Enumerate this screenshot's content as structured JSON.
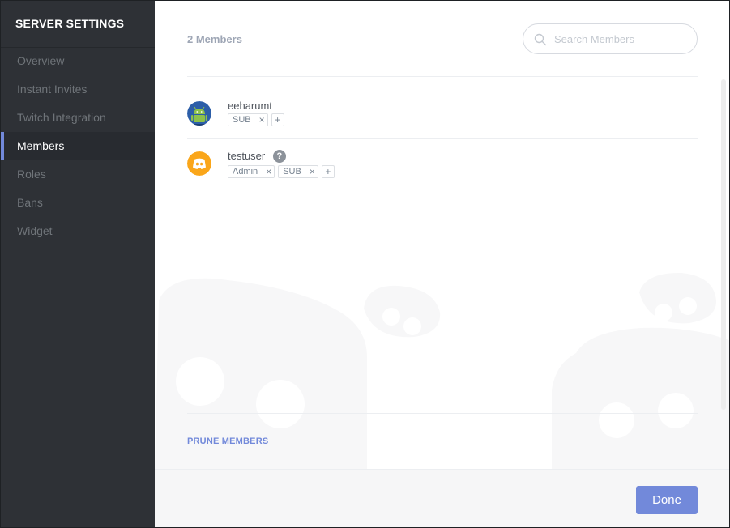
{
  "sidebar": {
    "title": "SERVER SETTINGS",
    "items": [
      {
        "label": "Overview",
        "active": false
      },
      {
        "label": "Instant Invites",
        "active": false
      },
      {
        "label": "Twitch Integration",
        "active": false
      },
      {
        "label": "Members",
        "active": true
      },
      {
        "label": "Roles",
        "active": false
      },
      {
        "label": "Bans",
        "active": false
      },
      {
        "label": "Widget",
        "active": false
      }
    ]
  },
  "members": {
    "count_label": "2 Members",
    "search_placeholder": "Search Members",
    "list": [
      {
        "name": "eeharumt",
        "avatar": "android-icon",
        "roles": [
          "SUB"
        ],
        "has_help": false
      },
      {
        "name": "testuser",
        "avatar": "discord-icon",
        "roles": [
          "Admin",
          "SUB"
        ],
        "has_help": true,
        "help_glyph": "?"
      }
    ],
    "prune_label": "PRUNE MEMBERS",
    "role_remove_glyph": "×",
    "role_add_glyph": "+"
  },
  "footer": {
    "done_label": "Done"
  },
  "colors": {
    "accent": "#7289da",
    "sidebar_bg": "#2e3136",
    "android_green": "#8dc14a",
    "discord_orange": "#faa61a"
  }
}
